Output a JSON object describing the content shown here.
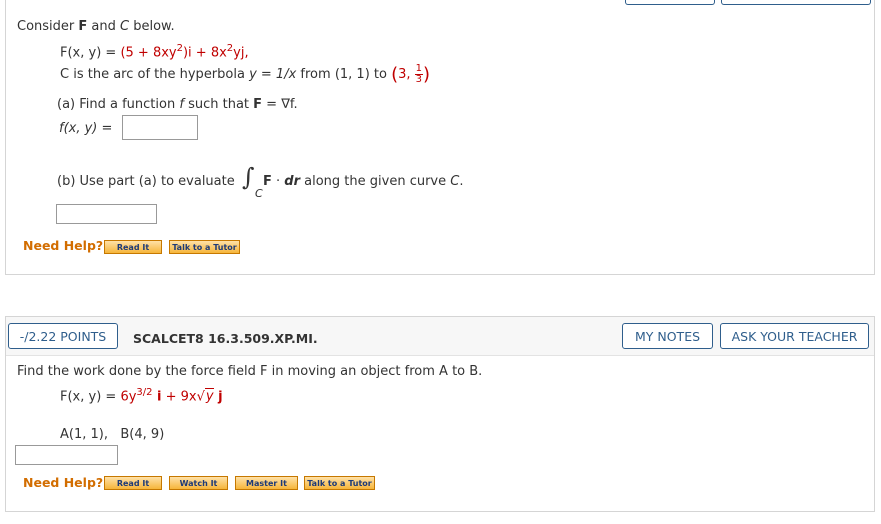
{
  "q1": {
    "intro": [
      "Consider ",
      "F",
      " and ",
      "C",
      " below."
    ],
    "field": {
      "lhs": "F(x, y) = ",
      "rhs_a": "(5 + 8xy",
      "sup_a": "2",
      "rhs_b": ")i + 8x",
      "sup_b": "2",
      "rhs_c": "yj,"
    },
    "curve": {
      "pre": "C is the arc of the hyperbola ",
      "eq": "y = 1/x",
      "mid": " from ",
      "p1": "(1, 1)",
      "to": " to ",
      "p2_x": "3, ",
      "p2_num": "1",
      "p2_den": "3"
    },
    "part_a": {
      "label": "(a) Find a function ",
      "f": "f",
      "rest": " such that ",
      "F": "F",
      "eq": " = ∇f.",
      "answer_label": "f(x, y) ="
    },
    "part_b": {
      "label": "(b) Use part (a) to evaluate",
      "integral_sub": "C",
      "integrand_F": "F",
      "dot": " · ",
      "integrand_dr": "dr",
      "rest": " along the given curve ",
      "curve": "C",
      "end": "."
    },
    "need_help": "Need Help?",
    "buttons": [
      "Read It",
      "Talk to a Tutor"
    ]
  },
  "q2": {
    "points": "-/2.22 POINTS",
    "code": "SCALCET8 16.3.509.XP.MI.",
    "my_notes": "MY NOTES",
    "ask_teacher": "ASK YOUR TEACHER",
    "prompt": "Find the work done by the force field F in moving an object from A to B.",
    "field": {
      "lhs": "F(x, y) = ",
      "a": "6y",
      "sup": "3/2",
      "i": " i",
      "plus": " + ",
      "b": "9x",
      "sqrt_arg": "y",
      "j": " j"
    },
    "points_line": {
      "A": "A(1, 1),",
      "B": "B(4, 9)"
    },
    "need_help": "Need Help?",
    "buttons": [
      "Read It",
      "Watch It",
      "Master It",
      "Talk to a Tutor"
    ]
  },
  "colors": {
    "accent": "#2f5e8c",
    "math": "#c00000",
    "help": "#d26d00"
  }
}
